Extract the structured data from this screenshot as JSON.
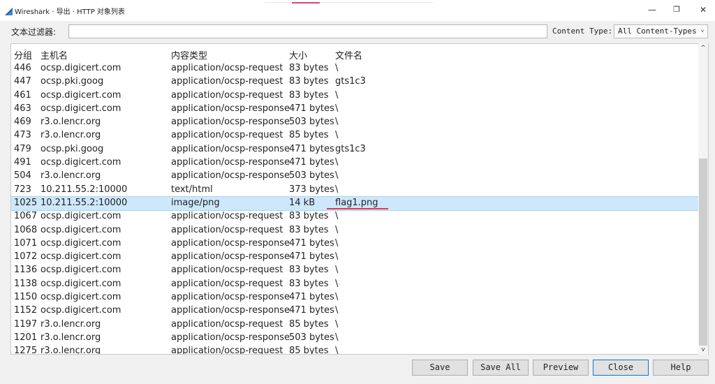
{
  "window": {
    "title": "Wireshark · 导出 · HTTP 对象列表",
    "minimize": "—",
    "restore": "❐",
    "close": "✕",
    "icon": "wireshark-fin-icon",
    "brand_color": "#1f5fb0"
  },
  "filter": {
    "label": "文本过滤器:",
    "value": "",
    "content_type_label": "Content Type:",
    "content_type_value": "All Content-Types"
  },
  "columns": [
    "分组",
    "主机名",
    "内容类型",
    "大小",
    "文件名"
  ],
  "rows": [
    {
      "packet": "446",
      "host": "ocsp.digicert.com",
      "type": "application/ocsp-request",
      "size": "83 bytes",
      "file": "\\"
    },
    {
      "packet": "447",
      "host": "ocsp.pki.goog",
      "type": "application/ocsp-request",
      "size": "83 bytes",
      "file": "gts1c3"
    },
    {
      "packet": "461",
      "host": "ocsp.digicert.com",
      "type": "application/ocsp-request",
      "size": "83 bytes",
      "file": "\\"
    },
    {
      "packet": "463",
      "host": "ocsp.digicert.com",
      "type": "application/ocsp-response",
      "size": "471 bytes",
      "file": "\\"
    },
    {
      "packet": "469",
      "host": "r3.o.lencr.org",
      "type": "application/ocsp-response",
      "size": "503 bytes",
      "file": "\\"
    },
    {
      "packet": "473",
      "host": "r3.o.lencr.org",
      "type": "application/ocsp-request",
      "size": "85 bytes",
      "file": "\\"
    },
    {
      "packet": "479",
      "host": "ocsp.pki.goog",
      "type": "application/ocsp-response",
      "size": "471 bytes",
      "file": "gts1c3"
    },
    {
      "packet": "491",
      "host": "ocsp.digicert.com",
      "type": "application/ocsp-response",
      "size": "471 bytes",
      "file": "\\"
    },
    {
      "packet": "504",
      "host": "r3.o.lencr.org",
      "type": "application/ocsp-response",
      "size": "503 bytes",
      "file": "\\"
    },
    {
      "packet": "723",
      "host": "10.211.55.2:10000",
      "type": "text/html",
      "size": "373 bytes",
      "file": "\\"
    },
    {
      "packet": "1025",
      "host": "10.211.55.2:10000",
      "type": "image/png",
      "size": "14 kB",
      "file": "flag1.png",
      "selected": true
    },
    {
      "packet": "1067",
      "host": "ocsp.digicert.com",
      "type": "application/ocsp-request",
      "size": "83 bytes",
      "file": "\\"
    },
    {
      "packet": "1068",
      "host": "ocsp.digicert.com",
      "type": "application/ocsp-request",
      "size": "83 bytes",
      "file": "\\"
    },
    {
      "packet": "1071",
      "host": "ocsp.digicert.com",
      "type": "application/ocsp-response",
      "size": "471 bytes",
      "file": "\\"
    },
    {
      "packet": "1072",
      "host": "ocsp.digicert.com",
      "type": "application/ocsp-response",
      "size": "471 bytes",
      "file": "\\"
    },
    {
      "packet": "1136",
      "host": "ocsp.digicert.com",
      "type": "application/ocsp-request",
      "size": "83 bytes",
      "file": "\\"
    },
    {
      "packet": "1138",
      "host": "ocsp.digicert.com",
      "type": "application/ocsp-request",
      "size": "83 bytes",
      "file": "\\"
    },
    {
      "packet": "1150",
      "host": "ocsp.digicert.com",
      "type": "application/ocsp-response",
      "size": "471 bytes",
      "file": "\\"
    },
    {
      "packet": "1152",
      "host": "ocsp.digicert.com",
      "type": "application/ocsp-response",
      "size": "471 bytes",
      "file": "\\"
    },
    {
      "packet": "1197",
      "host": "r3.o.lencr.org",
      "type": "application/ocsp-request",
      "size": "85 bytes",
      "file": "\\"
    },
    {
      "packet": "1201",
      "host": "r3.o.lencr.org",
      "type": "application/ocsp-response",
      "size": "503 bytes",
      "file": "\\"
    },
    {
      "packet": "1275",
      "host": "r3.o.lencr.org",
      "type": "application/ocsp-request",
      "size": "85 bytes",
      "file": "\\"
    }
  ],
  "buttons": {
    "save": "Save",
    "save_all": "Save All",
    "preview": "Preview",
    "close": "Close",
    "help": "Help"
  },
  "colors": {
    "selection": "#cde8fa",
    "annotation_underline": "#e03a52"
  }
}
